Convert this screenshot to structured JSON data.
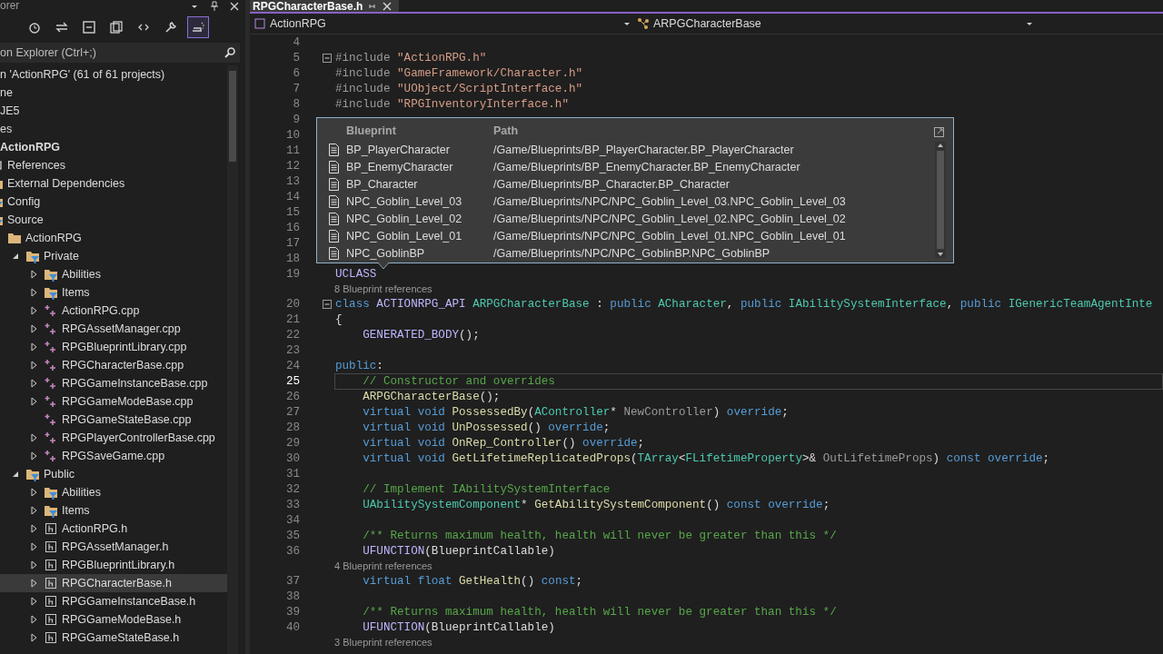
{
  "solution_explorer": {
    "title": "orer",
    "toolbar": [
      {
        "kind": "history",
        "selected": false
      },
      {
        "kind": "sync",
        "selected": false
      },
      {
        "kind": "collapse",
        "selected": false
      },
      {
        "kind": "pages",
        "selected": false
      },
      {
        "kind": "code",
        "selected": false
      },
      {
        "kind": "properties",
        "selected": false
      },
      {
        "kind": "preview",
        "selected": true
      }
    ],
    "search": {
      "placeholder": "on Explorer (Ctrl+;)"
    },
    "items": [
      {
        "label": "n 'ActionRPG' (61 of 61 projects)",
        "selected": false
      },
      {
        "label": "ne",
        "selected": false
      },
      {
        "label": "JE5",
        "selected": false
      },
      {
        "label": "es",
        "selected": false
      },
      {
        "label": "ActionRPG",
        "kind": "startup-project",
        "selected": false,
        "children": [
          {
            "label": "References",
            "kind": "references",
            "selected": false
          },
          {
            "label": "External Dependencies",
            "kind": "folder",
            "selected": false
          },
          {
            "label": "Config",
            "kind": "filter-folder",
            "selected": false
          },
          {
            "label": "Source",
            "kind": "filter-folder",
            "selected": false,
            "children": [
              {
                "label": "ActionRPG",
                "kind": "folder",
                "selected": false,
                "children": [
                  {
                    "label": "Private",
                    "kind": "filter-folder",
                    "expanded": true,
                    "selected": false,
                    "children": [
                      {
                        "label": "Abilities",
                        "kind": "filter-folder",
                        "expanded": false,
                        "selected": false
                      },
                      {
                        "label": "Items",
                        "kind": "filter-folder",
                        "expanded": false,
                        "selected": false
                      },
                      {
                        "label": "ActionRPG.cpp",
                        "kind": "cpp",
                        "expanded": false,
                        "selected": false
                      },
                      {
                        "label": "RPGAssetManager.cpp",
                        "kind": "cpp",
                        "expanded": false,
                        "selected": false
                      },
                      {
                        "label": "RPGBlueprintLibrary.cpp",
                        "kind": "cpp",
                        "expanded": false,
                        "selected": false
                      },
                      {
                        "label": "RPGCharacterBase.cpp",
                        "kind": "cpp",
                        "expanded": false,
                        "selected": false
                      },
                      {
                        "label": "RPGGameInstanceBase.cpp",
                        "kind": "cpp",
                        "expanded": false,
                        "selected": false
                      },
                      {
                        "label": "RPGGameModeBase.cpp",
                        "kind": "cpp",
                        "expanded": false,
                        "selected": false
                      },
                      {
                        "label": "RPGGameStateBase.cpp",
                        "kind": "cpp",
                        "selected": false
                      },
                      {
                        "label": "RPGPlayerControllerBase.cpp",
                        "kind": "cpp",
                        "expanded": false,
                        "selected": false
                      },
                      {
                        "label": "RPGSaveGame.cpp",
                        "kind": "cpp",
                        "expanded": false,
                        "selected": false
                      }
                    ]
                  },
                  {
                    "label": "Public",
                    "kind": "filter-folder",
                    "expanded": true,
                    "selected": false,
                    "children": [
                      {
                        "label": "Abilities",
                        "kind": "filter-folder",
                        "expanded": false,
                        "selected": false
                      },
                      {
                        "label": "Items",
                        "kind": "filter-folder",
                        "expanded": false,
                        "selected": false
                      },
                      {
                        "label": "ActionRPG.h",
                        "kind": "header",
                        "expanded": false,
                        "selected": false
                      },
                      {
                        "label": "RPGAssetManager.h",
                        "kind": "header",
                        "expanded": false,
                        "selected": false
                      },
                      {
                        "label": "RPGBlueprintLibrary.h",
                        "kind": "header",
                        "expanded": false,
                        "selected": false
                      },
                      {
                        "label": "RPGCharacterBase.h",
                        "kind": "header",
                        "expanded": false,
                        "selected": true
                      },
                      {
                        "label": "RPGGameInstanceBase.h",
                        "kind": "header",
                        "expanded": false,
                        "selected": false
                      },
                      {
                        "label": "RPGGameModeBase.h",
                        "kind": "header",
                        "expanded": false,
                        "selected": false
                      },
                      {
                        "label": "RPGGameStateBase.h",
                        "kind": "header",
                        "expanded": false,
                        "selected": false
                      }
                    ]
                  }
                ]
              }
            ]
          }
        ]
      }
    ]
  },
  "editor": {
    "tabs": [
      {
        "label": "RPGCharacterBase.h",
        "selected": true
      }
    ],
    "navigation": {
      "project": "ActionRPG",
      "scope": "ARPGCharacterBase"
    },
    "lines": [
      {
        "number": "4",
        "fold": false,
        "current": false
      },
      {
        "number": "5",
        "fold": true,
        "current": false,
        "tokens": [
          {
            "kind": "directive",
            "text": "#include "
          },
          {
            "kind": "string",
            "text": "\"ActionRPG.h\""
          }
        ]
      },
      {
        "number": "6",
        "fold": false,
        "current": false,
        "tokens": [
          {
            "kind": "directive",
            "text": "#include "
          },
          {
            "kind": "string",
            "text": "\"GameFramework/Character.h\""
          }
        ]
      },
      {
        "number": "7",
        "fold": false,
        "current": false,
        "tokens": [
          {
            "kind": "directive",
            "text": "#include "
          },
          {
            "kind": "string",
            "text": "\"UObject/ScriptInterface.h\""
          }
        ]
      },
      {
        "number": "8",
        "fold": false,
        "current": false,
        "tokens": [
          {
            "kind": "directive",
            "text": "#include "
          },
          {
            "kind": "string",
            "text": "\"RPGInventoryInterface.h\""
          }
        ]
      },
      {
        "number": "9",
        "fold": false,
        "current": false
      },
      {
        "number": "10",
        "fold": false,
        "current": false
      },
      {
        "number": "11",
        "fold": false,
        "current": false
      },
      {
        "number": "12",
        "fold": false,
        "current": false
      },
      {
        "number": "13",
        "fold": false,
        "current": false
      },
      {
        "number": "14",
        "fold": false,
        "current": false
      },
      {
        "number": "15",
        "fold": false,
        "current": false
      },
      {
        "number": "16",
        "fold": false,
        "current": false
      },
      {
        "number": "17",
        "fold": false,
        "current": false
      },
      {
        "number": "18",
        "fold": false,
        "current": false
      },
      {
        "number": "19",
        "fold": false,
        "current": false,
        "tokens": [
          {
            "kind": "macro",
            "text": "UCLASS"
          }
        ],
        "codelens": "8 Blueprint references"
      },
      {
        "number": "20",
        "fold": true,
        "current": false,
        "tokens": [
          {
            "kind": "keyword",
            "text": "class "
          },
          {
            "kind": "macro",
            "text": "ACTIONRPG_API "
          },
          {
            "kind": "type",
            "text": "ARPGCharacterBase"
          },
          {
            "kind": "plain",
            "text": " : "
          },
          {
            "kind": "keyword",
            "text": "public "
          },
          {
            "kind": "type",
            "text": "ACharacter"
          },
          {
            "kind": "plain",
            "text": ", "
          },
          {
            "kind": "keyword",
            "text": "public "
          },
          {
            "kind": "type",
            "text": "IAbilitySystemInterface"
          },
          {
            "kind": "plain",
            "text": ", "
          },
          {
            "kind": "keyword",
            "text": "public "
          },
          {
            "kind": "type",
            "text": "IGenericTeamAgentInte"
          }
        ]
      },
      {
        "number": "21",
        "fold": false,
        "current": false,
        "tokens": [
          {
            "kind": "plain",
            "text": "{"
          }
        ]
      },
      {
        "number": "22",
        "fold": false,
        "current": false,
        "tokens": [
          {
            "kind": "macro",
            "text": "    GENERATED_BODY"
          },
          {
            "kind": "plain",
            "text": "();"
          }
        ]
      },
      {
        "number": "23",
        "fold": false,
        "current": false
      },
      {
        "number": "24",
        "fold": false,
        "current": false,
        "tokens": [
          {
            "kind": "keyword",
            "text": "public"
          },
          {
            "kind": "plain",
            "text": ":"
          }
        ]
      },
      {
        "number": "25",
        "fold": false,
        "current": true,
        "tokens": [
          {
            "kind": "comment",
            "text": "    // Constructor and overrides"
          }
        ]
      },
      {
        "number": "26",
        "fold": false,
        "current": false,
        "tokens": [
          {
            "kind": "function",
            "text": "    ARPGCharacterBase"
          },
          {
            "kind": "plain",
            "text": "();"
          }
        ]
      },
      {
        "number": "27",
        "fold": false,
        "current": false,
        "tokens": [
          {
            "kind": "keyword",
            "text": "    virtual void "
          },
          {
            "kind": "function",
            "text": "PossessedBy"
          },
          {
            "kind": "plain",
            "text": "("
          },
          {
            "kind": "type",
            "text": "AController"
          },
          {
            "kind": "plain",
            "text": "* "
          },
          {
            "kind": "param",
            "text": "NewController"
          },
          {
            "kind": "plain",
            "text": ") "
          },
          {
            "kind": "keyword",
            "text": "override"
          },
          {
            "kind": "plain",
            "text": ";"
          }
        ]
      },
      {
        "number": "28",
        "fold": false,
        "current": false,
        "tokens": [
          {
            "kind": "keyword",
            "text": "    virtual void "
          },
          {
            "kind": "function",
            "text": "UnPossessed"
          },
          {
            "kind": "plain",
            "text": "() "
          },
          {
            "kind": "keyword",
            "text": "override"
          },
          {
            "kind": "plain",
            "text": ";"
          }
        ]
      },
      {
        "number": "29",
        "fold": false,
        "current": false,
        "tokens": [
          {
            "kind": "keyword",
            "text": "    virtual void "
          },
          {
            "kind": "function",
            "text": "OnRep_Controller"
          },
          {
            "kind": "plain",
            "text": "() "
          },
          {
            "kind": "keyword",
            "text": "override"
          },
          {
            "kind": "plain",
            "text": ";"
          }
        ]
      },
      {
        "number": "30",
        "fold": false,
        "current": false,
        "tokens": [
          {
            "kind": "keyword",
            "text": "    virtual void "
          },
          {
            "kind": "function",
            "text": "GetLifetimeReplicatedProps"
          },
          {
            "kind": "plain",
            "text": "("
          },
          {
            "kind": "type",
            "text": "TArray"
          },
          {
            "kind": "plain",
            "text": "<"
          },
          {
            "kind": "type",
            "text": "FLifetimeProperty"
          },
          {
            "kind": "plain",
            "text": ">& "
          },
          {
            "kind": "param",
            "text": "OutLifetimeProps"
          },
          {
            "kind": "plain",
            "text": ") "
          },
          {
            "kind": "keyword",
            "text": "const override"
          },
          {
            "kind": "plain",
            "text": ";"
          }
        ]
      },
      {
        "number": "31",
        "fold": false,
        "current": false
      },
      {
        "number": "32",
        "fold": false,
        "current": false,
        "tokens": [
          {
            "kind": "comment",
            "text": "    // Implement IAbilitySystemInterface"
          }
        ]
      },
      {
        "number": "33",
        "fold": false,
        "current": false,
        "tokens": [
          {
            "kind": "type",
            "text": "    UAbilitySystemComponent"
          },
          {
            "kind": "plain",
            "text": "* "
          },
          {
            "kind": "function",
            "text": "GetAbilitySystemComponent"
          },
          {
            "kind": "plain",
            "text": "() "
          },
          {
            "kind": "keyword",
            "text": "const override"
          },
          {
            "kind": "plain",
            "text": ";"
          }
        ]
      },
      {
        "number": "34",
        "fold": false,
        "current": false
      },
      {
        "number": "35",
        "fold": false,
        "current": false,
        "tokens": [
          {
            "kind": "comment",
            "text": "    /** Returns maximum health, health will never be greater than this */"
          }
        ]
      },
      {
        "number": "36",
        "fold": false,
        "current": false,
        "tokens": [
          {
            "kind": "macro",
            "text": "    UFUNCTION"
          },
          {
            "kind": "plain",
            "text": "(BlueprintCallable)"
          }
        ],
        "codelens": "4 Blueprint references"
      },
      {
        "number": "37",
        "fold": false,
        "current": false,
        "tokens": [
          {
            "kind": "keyword",
            "text": "    virtual float "
          },
          {
            "kind": "function",
            "text": "GetHealth"
          },
          {
            "kind": "plain",
            "text": "() "
          },
          {
            "kind": "keyword",
            "text": "const"
          },
          {
            "kind": "plain",
            "text": ";"
          }
        ]
      },
      {
        "number": "38",
        "fold": false,
        "current": false
      },
      {
        "number": "39",
        "fold": false,
        "current": false,
        "tokens": [
          {
            "kind": "comment",
            "text": "    /** Returns maximum health, health will never be greater than this */"
          }
        ]
      },
      {
        "number": "40",
        "fold": false,
        "current": false,
        "tokens": [
          {
            "kind": "macro",
            "text": "    UFUNCTION"
          },
          {
            "kind": "plain",
            "text": "(BlueprintCallable)"
          }
        ],
        "codelens": "3 Blueprint references"
      }
    ],
    "blueprint_popup": {
      "columns": [
        "Blueprint",
        "Path"
      ],
      "rows": [
        {
          "name": "BP_PlayerCharacter",
          "path": "/Game/Blueprints/BP_PlayerCharacter.BP_PlayerCharacter"
        },
        {
          "name": "BP_EnemyCharacter",
          "path": "/Game/Blueprints/BP_EnemyCharacter.BP_EnemyCharacter"
        },
        {
          "name": "BP_Character",
          "path": "/Game/Blueprints/BP_Character.BP_Character"
        },
        {
          "name": "NPC_Goblin_Level_03",
          "path": "/Game/Blueprints/NPC/NPC_Goblin_Level_03.NPC_Goblin_Level_03"
        },
        {
          "name": "NPC_Goblin_Level_02",
          "path": "/Game/Blueprints/NPC/NPC_Goblin_Level_02.NPC_Goblin_Level_02"
        },
        {
          "name": "NPC_Goblin_Level_01",
          "path": "/Game/Blueprints/NPC/NPC_Goblin_Level_01.NPC_Goblin_Level_01"
        },
        {
          "name": "NPC_GoblinBP",
          "path": "/Game/Blueprints/NPC/NPC_GoblinBP.NPC_GoblinBP"
        }
      ]
    }
  }
}
